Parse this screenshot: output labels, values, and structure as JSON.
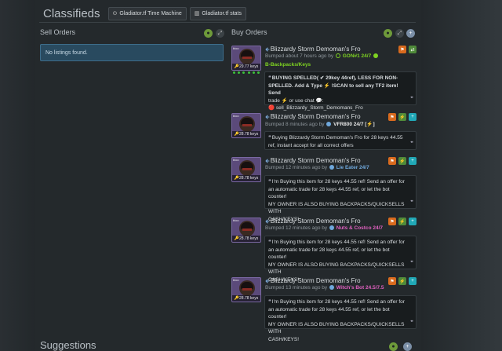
{
  "header": {
    "title": "Classifieds",
    "btn_time_machine": "Gladiator.tf Time Machine",
    "btn_stats": "Gladiator.tf stats"
  },
  "sell": {
    "title": "Sell Orders",
    "empty": "No listings found."
  },
  "buy": {
    "title": "Buy Orders"
  },
  "suggestions": {
    "title": "Suggestions"
  },
  "listings": [
    {
      "level": "bloo",
      "name": "Blizzardy Storm Demoman's Fro",
      "keys": "29.77 keys",
      "bumped": "Bumped about 7 hours ago by",
      "user": "GON#1 24/7",
      "user_color": "#7ed321",
      "tag": "B-Backpacks/Keys",
      "desc_lines": [
        "BUYING SPELLED( ✔ 29key 44ref), LESS FOR NON-",
        "SPELLED. Add & Type ⚡ !SCAN to sell any TF2 item! Send",
        "trade ⚡ or use chat 💬:",
        "🔴 sell_Blizzardy_Storm_Demomans_Fro"
      ]
    },
    {
      "level": "bloo",
      "name": "Blizzardy Storm Demoman's Fro",
      "keys": "28.78 keys",
      "bumped": "Bumped 8 minutes ago by",
      "user": "VFR800 24/7 [⚡]",
      "user_color": "#e6e6e6",
      "desc_lines": [
        "Buying Blizzardy Storm Demoman's Fro for 28 keys 44.55",
        "ref, instant accept for all correct offers"
      ]
    },
    {
      "level": "bloo",
      "name": "Blizzardy Storm Demoman's Fro",
      "keys": "28.78 keys",
      "bumped": "Bumped 12 minutes ago by",
      "user": "Lie Eater 24/7",
      "user_color": "#6fa8dc",
      "desc_lines": [
        "I'm Buying this item for 28 keys 44.55 ref! Send an offer for",
        "an automatic trade for 28 keys 44.55 ref, or let the bot counter!",
        "MY OWNER IS ALSO BUYING BACKPACKS/QUICKSELLS WITH",
        "CASH/KEYS!"
      ]
    },
    {
      "level": "bloo",
      "name": "Blizzardy Storm Demoman's Fro",
      "keys": "28.78 keys",
      "bumped": "Bumped 12 minutes ago by",
      "user": "Nuts & Costco 24/7",
      "user_color": "#e060c0",
      "desc_lines": [
        "I'm Buying this item for 28 keys 44.55 ref! Send an offer for",
        "an automatic trade for 28 keys 44.55 ref, or let the bot counter!",
        "MY OWNER IS ALSO BUYING BACKPACKS/QUICKSELLS WITH",
        "CASH/KEYS!"
      ]
    },
    {
      "level": "bloo",
      "name": "Blizzardy Storm Demoman's Fro",
      "keys": "28.78 keys",
      "bumped": "Bumped 13 minutes ago by",
      "user": "Witch's Bot 24.5/7.5",
      "user_color": "#e060c0",
      "desc_lines": [
        "I'm Buying this item for 28 keys 44.55 ref! Send an offer for",
        "an automatic trade for 28 keys 44.55 ref, or let the bot counter!",
        "MY OWNER IS ALSO BUYING BACKPACKS/QUICKSELLS WITH",
        "CASH/KEYS!"
      ]
    }
  ]
}
